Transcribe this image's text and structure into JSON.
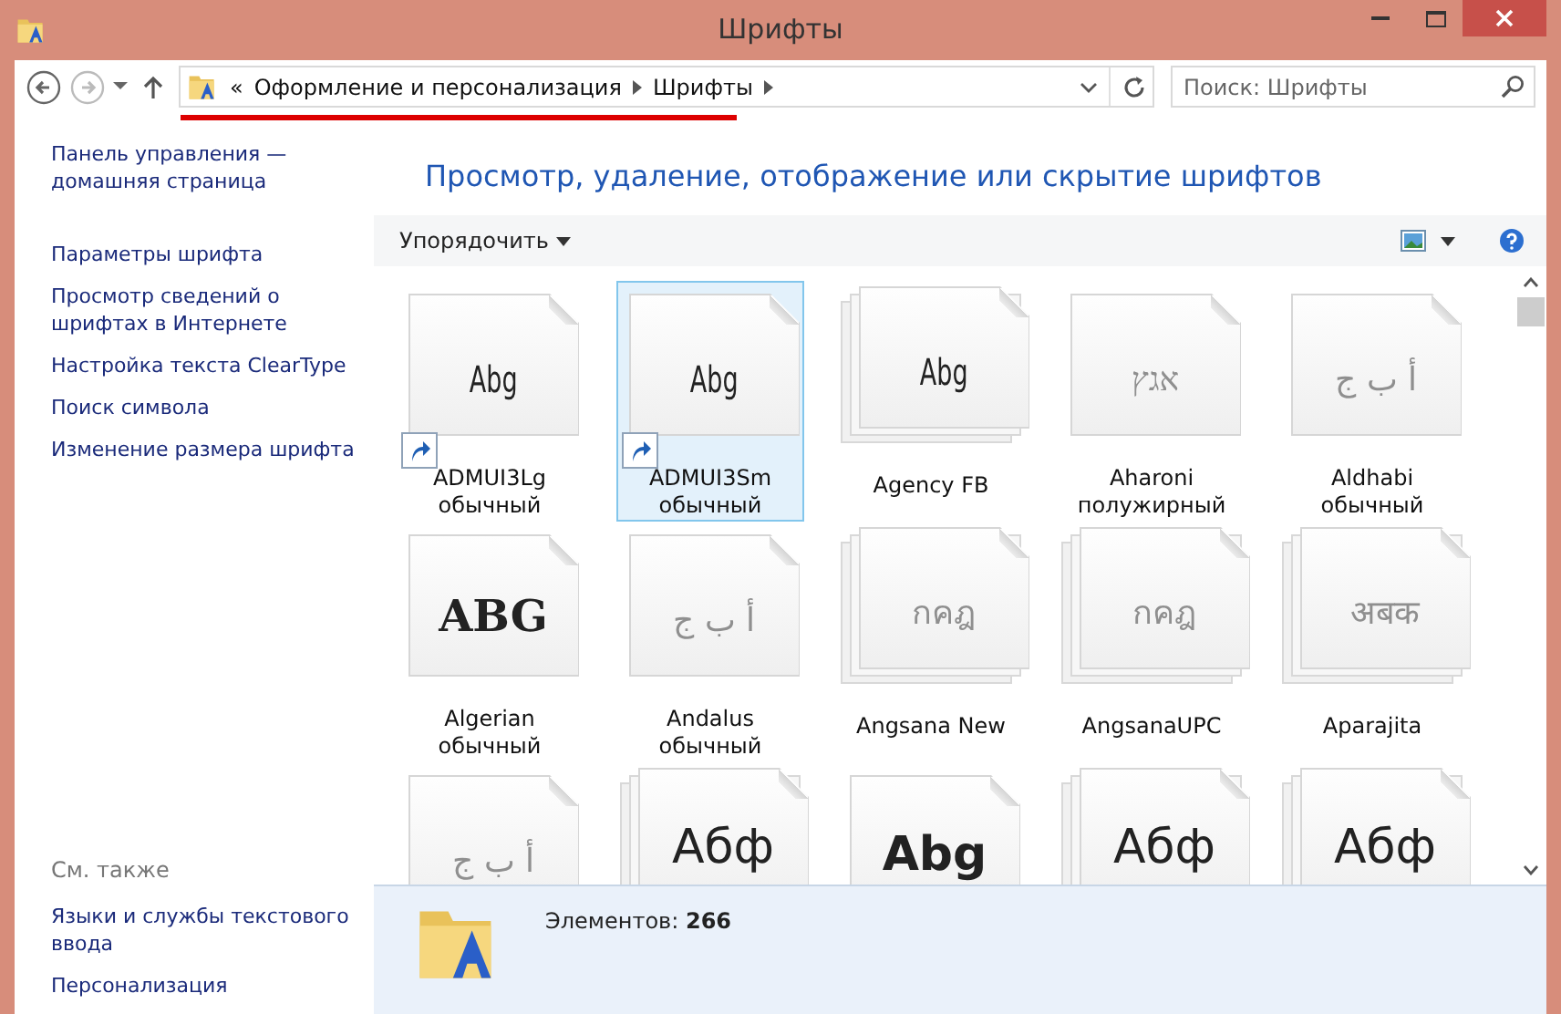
{
  "window": {
    "title": "Шрифты"
  },
  "nav": {
    "back_disabled": false,
    "forward_disabled": true
  },
  "address": {
    "overflow": "«",
    "crumbs": [
      "Оформление и персонализация",
      "Шрифты"
    ],
    "underlined": true
  },
  "search": {
    "placeholder": "Поиск: Шрифты"
  },
  "sidebar": {
    "links": [
      "Панель управления — домашняя страница",
      "Параметры шрифта",
      "Просмотр сведений о шрифтах в Интернете",
      "Настройка текста ClearType",
      "Поиск символа",
      "Изменение размера шрифта"
    ],
    "see_also": {
      "title": "См. также",
      "links": [
        "Языки и службы текстового ввода",
        "Персонализация"
      ]
    }
  },
  "heading": "Просмотр, удаление, отображение или скрытие шрифтов",
  "toolbar": {
    "organize": "Упорядочить"
  },
  "fonts": [
    {
      "preview": "Abg",
      "kind": "narrow",
      "name": "ADMUI3Lg",
      "style": "обычный",
      "family": false,
      "hidden": false,
      "shortcut": true,
      "selected": false
    },
    {
      "preview": "Abg",
      "kind": "narrow",
      "name": "ADMUI3Sm",
      "style": "обычный",
      "family": false,
      "hidden": false,
      "shortcut": true,
      "selected": true
    },
    {
      "preview": "Abg",
      "kind": "narrow",
      "name": "Agency FB",
      "family": true,
      "hidden": false,
      "shortcut": false,
      "selected": false
    },
    {
      "preview": "אגץ",
      "kind": "serif",
      "name": "Aharoni",
      "style": "полужирный",
      "family": false,
      "hidden": true,
      "shortcut": false,
      "selected": false
    },
    {
      "preview": "أ ب ج",
      "kind": "serif",
      "name": "Aldhabi",
      "style": "обычный",
      "family": false,
      "hidden": true,
      "shortcut": false,
      "selected": false
    },
    {
      "preview": "ABG",
      "kind": "decorative",
      "name": "Algerian",
      "style": "обычный",
      "family": false,
      "hidden": false,
      "shortcut": false,
      "selected": false
    },
    {
      "preview": "أ ب ج",
      "kind": "serif",
      "name": "Andalus",
      "style": "обычный",
      "family": false,
      "hidden": true,
      "shortcut": false,
      "selected": false
    },
    {
      "preview": "กคฎ",
      "kind": "serif",
      "name": "Angsana New",
      "family": true,
      "hidden": true,
      "shortcut": false,
      "selected": false
    },
    {
      "preview": "กคฎ",
      "kind": "serif",
      "name": "AngsanaUPC",
      "family": true,
      "hidden": true,
      "shortcut": false,
      "selected": false
    },
    {
      "preview": "अबक",
      "kind": "serif",
      "name": "Aparajita",
      "family": true,
      "hidden": true,
      "shortcut": false,
      "selected": false
    },
    {
      "preview": "أ ب ج",
      "kind": "serif",
      "family": false,
      "hidden": true,
      "shortcut": false,
      "selected": false
    },
    {
      "preview": "Абф",
      "kind": "sans",
      "family": true,
      "hidden": false,
      "shortcut": false,
      "selected": false
    },
    {
      "preview": "Abg",
      "kind": "bold",
      "family": false,
      "hidden": false,
      "shortcut": false,
      "selected": false
    },
    {
      "preview": "Абф",
      "kind": "sans",
      "family": true,
      "hidden": false,
      "shortcut": false,
      "selected": false
    },
    {
      "preview": "Абф",
      "kind": "sans",
      "family": true,
      "hidden": false,
      "shortcut": false,
      "selected": false
    }
  ],
  "status_bar": {
    "text": "Элементов: **266**"
  }
}
